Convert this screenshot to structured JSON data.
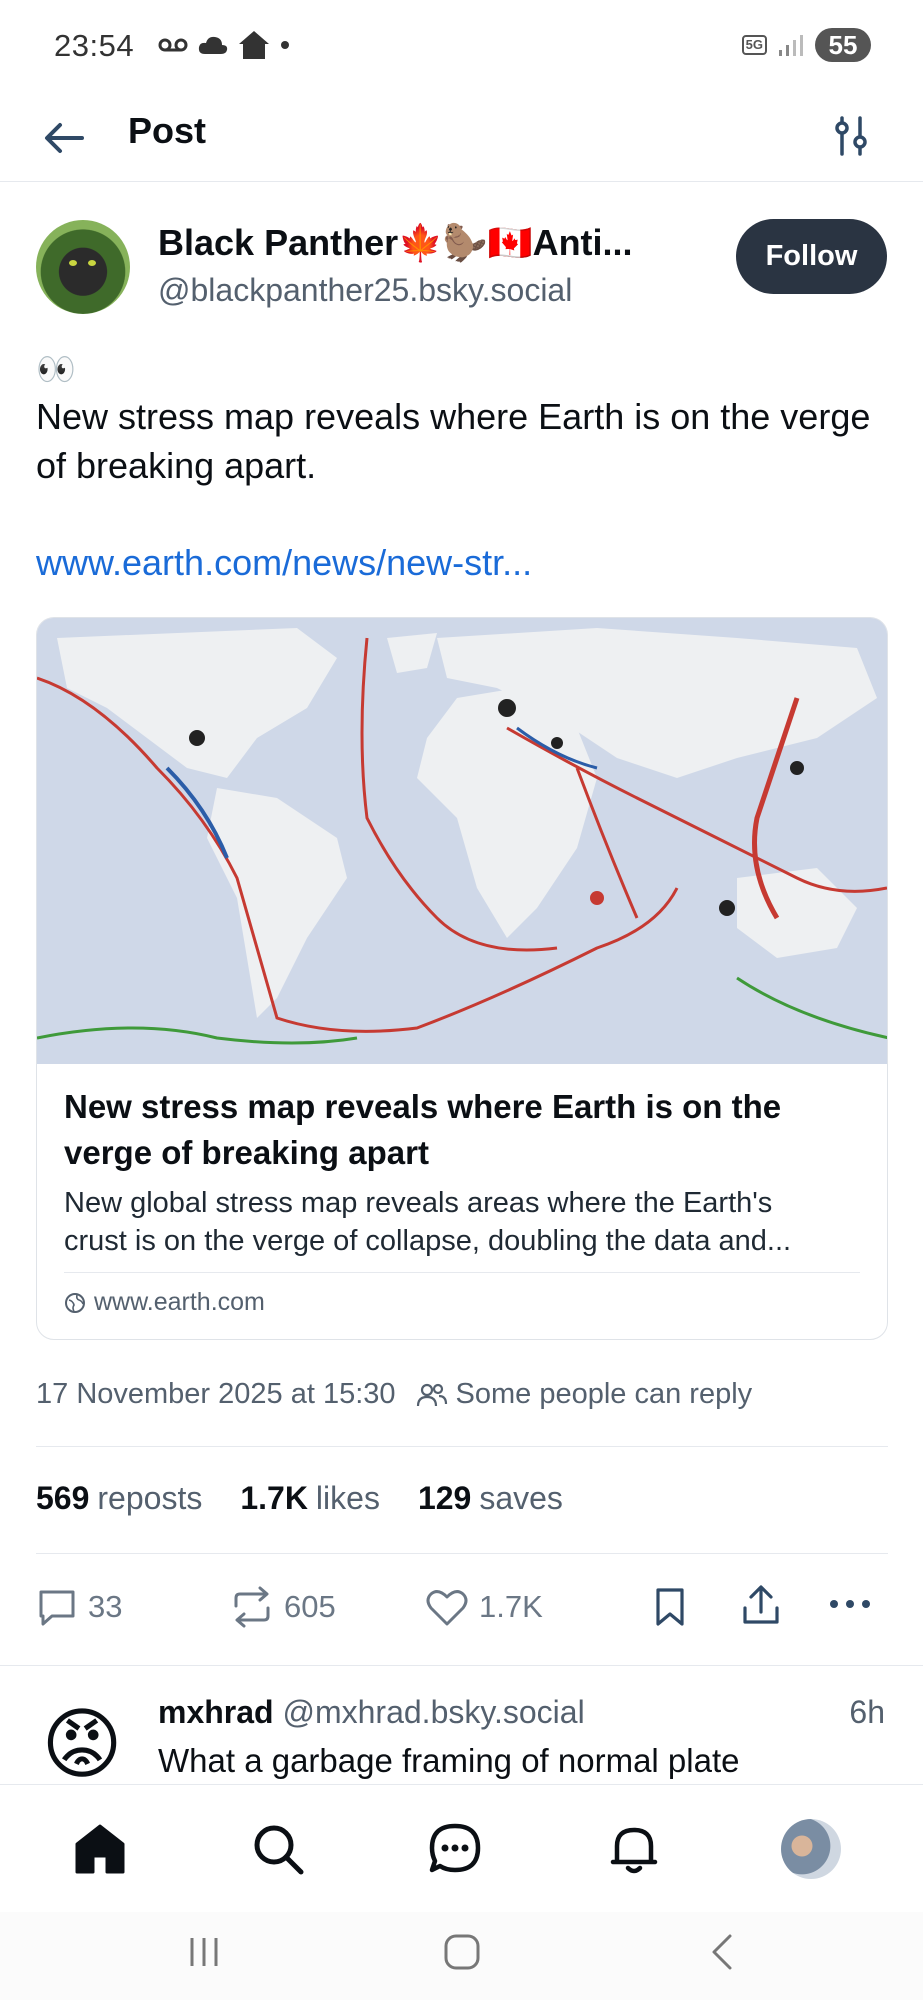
{
  "status_bar": {
    "time": "23:54",
    "battery": "55",
    "network": "5G"
  },
  "header": {
    "title": "Post"
  },
  "author": {
    "name": "Black Panther🍁🦫🇨🇦Anti...",
    "handle": "@blackpanther25.bsky.social",
    "follow_label": "Follow"
  },
  "post": {
    "emoji": "👀",
    "text": "New stress map reveals where Earth is on the verge of breaking apart.",
    "link_text": "www.earth.com/news/new-str..."
  },
  "link_card": {
    "title": "New stress map reveals where Earth is on the verge of breaking apart",
    "description": "New global stress map reveals areas where the Earth's\ncrust is on the verge of collapse, doubling the data and...",
    "domain": "www.earth.com"
  },
  "meta": {
    "timestamp": "17 November 2025 at 15:30",
    "reply_setting": "Some people can reply"
  },
  "stats": {
    "reposts_count": "569",
    "reposts_label": "reposts",
    "likes_count": "1.7K",
    "likes_label": "likes",
    "saves_count": "129",
    "saves_label": "saves"
  },
  "actions": {
    "replies": "33",
    "reposts": "605",
    "likes": "1.7K"
  },
  "reply": {
    "emoji": "😡",
    "name": "mxhrad",
    "handle": "@mxhrad.bsky.social",
    "time": "6h",
    "text": "What a garbage framing of normal plate"
  },
  "colors": {
    "accent_link": "#1a6bd8",
    "follow_button": "#2a3442",
    "muted_text": "#54606e"
  },
  "icons": [
    "back-arrow-icon",
    "filter-icon",
    "globe-icon",
    "people-icon",
    "reply-icon",
    "repost-icon",
    "heart-icon",
    "bookmark-icon",
    "share-icon",
    "more-icon",
    "home-icon",
    "search-icon",
    "chat-icon",
    "bell-icon"
  ]
}
